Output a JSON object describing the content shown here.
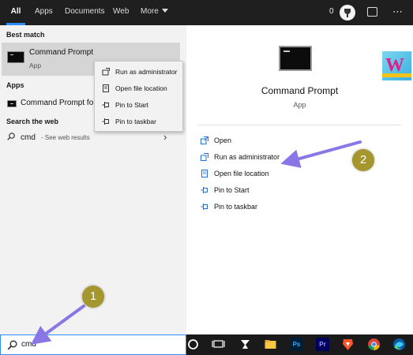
{
  "tabs": [
    {
      "label": "All",
      "active": true
    },
    {
      "label": "Apps"
    },
    {
      "label": "Documents"
    },
    {
      "label": "Web"
    },
    {
      "label": "More"
    }
  ],
  "header": {
    "points": "0",
    "icons": [
      "trophy-icon",
      "feedback-icon",
      "more-options-icon"
    ]
  },
  "left": {
    "best_match_heading": "Best match",
    "best_match": {
      "title": "Command Prompt",
      "subtitle": "App"
    },
    "apps_heading": "Apps",
    "app_item": "Command Prompt fo",
    "web_heading": "Search the web",
    "web_item": {
      "query": "cmd",
      "suffix": "- See web results"
    }
  },
  "context_menu": [
    {
      "label": "Run as administrator",
      "icon": "shield-run-icon"
    },
    {
      "label": "Open file location",
      "icon": "file-location-icon"
    },
    {
      "label": "Pin to Start",
      "icon": "pin-icon"
    },
    {
      "label": "Pin to taskbar",
      "icon": "pin-icon"
    }
  ],
  "right": {
    "title": "Command Prompt",
    "subtitle": "App",
    "actions": [
      {
        "label": "Open",
        "icon": "open-icon"
      },
      {
        "label": "Run as administrator",
        "icon": "shield-run-icon"
      },
      {
        "label": "Open file location",
        "icon": "file-location-icon"
      },
      {
        "label": "Pin to Start",
        "icon": "pin-icon"
      },
      {
        "label": "Pin to taskbar",
        "icon": "pin-icon"
      }
    ]
  },
  "search": {
    "value": "cmd"
  },
  "taskbar": {
    "apps": [
      {
        "label": "Ps",
        "color": "#31a8ff",
        "bg": "#001e36"
      },
      {
        "label": "Pr",
        "color": "#9999ff",
        "bg": "#00005b"
      }
    ],
    "icons": [
      "cortana-icon",
      "task-view-icon",
      "app-icon",
      "file-explorer-icon",
      "photoshop-icon",
      "premiere-icon",
      "brave-icon",
      "chrome-icon",
      "edge-icon"
    ]
  },
  "annotations": {
    "step1": "1",
    "step2": "2"
  },
  "colors": {
    "accent": "#2d8cff",
    "arrow": "#8a76e6",
    "badge": "#a6962e"
  }
}
